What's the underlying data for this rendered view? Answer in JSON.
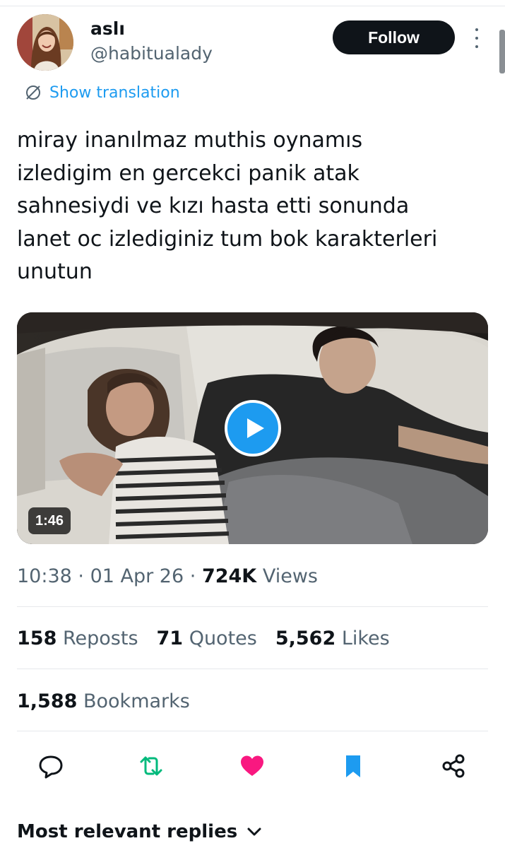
{
  "author": {
    "display_name": "aslı",
    "handle": "@habitualady"
  },
  "header": {
    "follow_label": "Follow",
    "more_icon": "more-vertical-icon"
  },
  "translation": {
    "label": "Show translation",
    "icon": "translate-icon"
  },
  "tweet": {
    "text": "miray inanılmaz muthis oynamıs\nizledigim en gercekci panik atak\nsahnesiydi ve kızı hasta etti sonunda\nlanet oc izlediginiz tum bok karakterleri\nunutun"
  },
  "media": {
    "duration": "1:46",
    "play_icon": "play-icon"
  },
  "meta": {
    "time": "10:38",
    "date": "01 Apr 26",
    "views_count": "724K",
    "views_label": "Views"
  },
  "stats": {
    "reposts_count": "158",
    "reposts_label": "Reposts",
    "quotes_count": "71",
    "quotes_label": "Quotes",
    "likes_count": "5,562",
    "likes_label": "Likes",
    "bookmarks_count": "1,588",
    "bookmarks_label": "Bookmarks"
  },
  "actions": {
    "reply_icon": "reply-icon",
    "repost_icon": "repost-icon",
    "like_icon": "heart-icon",
    "bookmark_icon": "bookmark-icon",
    "share_icon": "share-icon"
  },
  "colors": {
    "accent": "#1d9bf0",
    "repost": "#00ba7c",
    "like": "#f91880",
    "text": "#0f1419",
    "muted": "#536471"
  },
  "replies": {
    "label": "Most relevant replies"
  }
}
